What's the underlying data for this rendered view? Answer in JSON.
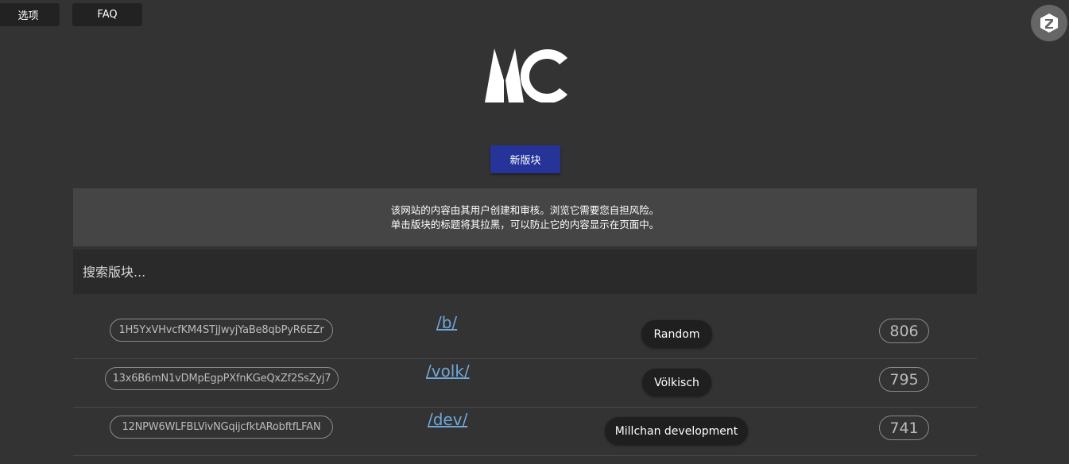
{
  "nav": {
    "options_label": "选项",
    "faq_label": "FAQ"
  },
  "logo": {
    "text": "MC"
  },
  "new_board_label": "新版块",
  "notice": {
    "line1": "该网站的内容由其用户创建和审核。浏览它需要您自担风险。",
    "line2": "单击版块的标题将其拉黑，可以防止它的内容显示在页面中。"
  },
  "search": {
    "placeholder": "搜索版块..."
  },
  "boards": [
    {
      "address": "1H5YxVHvcfKM4STjJwyjYaBe8qbPyR6EZr",
      "uri": "/b/",
      "title": "Random",
      "posts": "806"
    },
    {
      "address": "13x6B6mN1vDMpEgpPXfnKGeQxZf2SsZyj7",
      "uri": "/volk/",
      "title": "Völkisch",
      "posts": "795"
    },
    {
      "address": "12NPW6WLFBLVivNGqijcfktARobftfLFAN",
      "uri": "/dev/",
      "title": "Millchan development",
      "posts": "741"
    }
  ],
  "colors": {
    "background": "#333333",
    "accent_button": "#26349a",
    "link": "#6fa7d9"
  },
  "icons": {
    "corner": "zeronet-logo-icon"
  }
}
